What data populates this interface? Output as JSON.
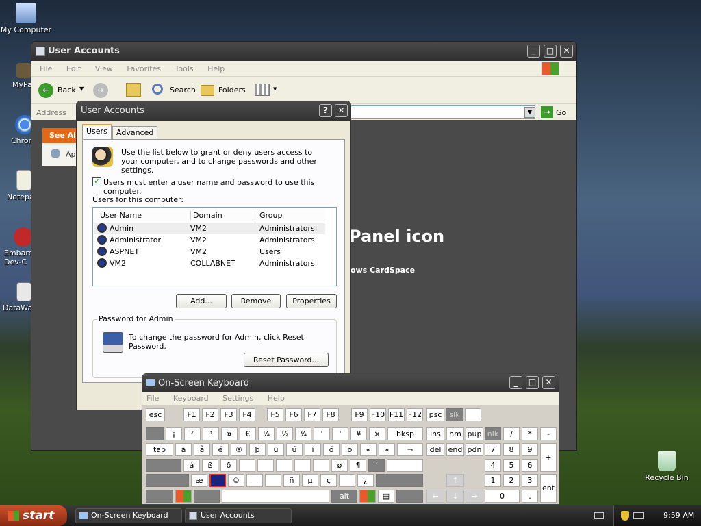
{
  "desktop": {
    "icons": [
      {
        "label": "My Computer"
      },
      {
        "label": "MyPa"
      },
      {
        "label": "Chrom"
      },
      {
        "label": "Notepa"
      },
      {
        "label": "Embarca Dev-C"
      },
      {
        "label": "DataWa"
      },
      {
        "label": "Recycle Bin"
      }
    ]
  },
  "explorer": {
    "title": "User Accounts",
    "menu": [
      "File",
      "Edit",
      "View",
      "Favorites",
      "Tools",
      "Help"
    ],
    "toolbar": {
      "back": "Back",
      "search": "Search",
      "folders": "Folders"
    },
    "address_label": "Address",
    "go": "Go",
    "see_also": "See Al",
    "side_item": "Ap",
    "heading": "Panel icon",
    "sub": "ows CardSpace"
  },
  "dialog": {
    "title": "User Accounts",
    "help_btn": "?",
    "close_btn": "✕",
    "tabs": [
      "Users",
      "Advanced"
    ],
    "intro": "Use the list below to grant or deny users access to your computer, and to change passwords and other settings.",
    "checkbox_label": "Users must enter a user name and password to use this computer.",
    "checkbox_checked": true,
    "list_label": "Users for this computer:",
    "columns": [
      "User Name",
      "Domain",
      "Group"
    ],
    "rows": [
      {
        "name": "Admin",
        "domain": "VM2",
        "group": "Administrators; ..."
      },
      {
        "name": "Administrator",
        "domain": "VM2",
        "group": "Administrators"
      },
      {
        "name": "ASPNET",
        "domain": "VM2",
        "group": "Users"
      },
      {
        "name": "VM2",
        "domain": "COLLABNET",
        "group": "Administrators"
      }
    ],
    "buttons": {
      "add": "Add...",
      "remove": "Remove",
      "properties": "Properties"
    },
    "pw_group": "Password for Admin",
    "pw_text": "To change the password for Admin, click Reset Password.",
    "reset_btn": "Reset Password..."
  },
  "osk": {
    "title": "On-Screen Keyboard",
    "menu": [
      "File",
      "Keyboard",
      "Settings",
      "Help"
    ],
    "rows": {
      "r1": [
        "esc",
        "F1",
        "F2",
        "F3",
        "F4",
        "F5",
        "F6",
        "F7",
        "F8",
        "F9",
        "F10",
        "F11",
        "F12",
        "psc",
        "slk",
        ""
      ],
      "r2": [
        "",
        "¡",
        "²",
        "³",
        "¤",
        "€",
        "¼",
        "½",
        "¾",
        "'",
        "'",
        "¥",
        "×",
        "bksp",
        "ins",
        "hm",
        "pup",
        "nlk",
        "/",
        "*",
        "-"
      ],
      "r3": [
        "tab",
        "ä",
        "å",
        "é",
        "®",
        "þ",
        "ü",
        "ú",
        "í",
        "ó",
        "ö",
        "«",
        "»",
        "¬",
        "del",
        "end",
        "pdn",
        "7",
        "8",
        "9",
        "+"
      ],
      "r4": [
        "",
        "á",
        "ß",
        "ð",
        "",
        "",
        "",
        "",
        "",
        "ø",
        "¶",
        "´",
        "",
        "4",
        "5",
        "6"
      ],
      "r5": [
        "",
        "æ",
        "",
        "©",
        "",
        "",
        "ñ",
        "µ",
        "ç",
        "",
        "¿",
        "",
        "1",
        "2",
        "3",
        "ent"
      ],
      "r6": [
        "",
        "",
        "",
        "",
        "alt",
        "",
        "",
        "",
        "0",
        "."
      ]
    }
  },
  "taskbar": {
    "start": "start",
    "items": [
      "On-Screen Keyboard",
      "User Accounts"
    ],
    "clock": "9:59 AM"
  }
}
